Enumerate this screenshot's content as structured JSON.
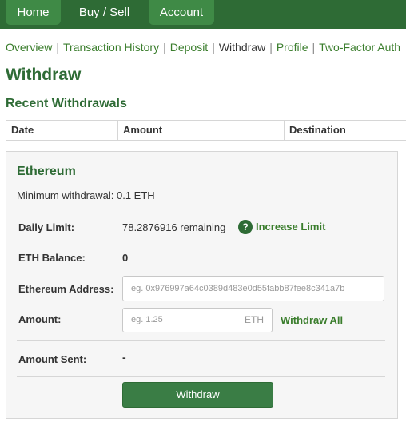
{
  "topnav": {
    "tabs": [
      {
        "label": "Home"
      },
      {
        "label": "Buy / Sell"
      },
      {
        "label": "Account"
      }
    ]
  },
  "subnav": {
    "items": [
      {
        "label": "Overview"
      },
      {
        "label": "Transaction History"
      },
      {
        "label": "Deposit"
      },
      {
        "label": "Withdraw"
      },
      {
        "label": "Profile"
      },
      {
        "label": "Two-Factor Auth"
      }
    ],
    "separator": "|",
    "active": "Withdraw"
  },
  "page": {
    "title": "Withdraw",
    "recent_title": "Recent Withdrawals"
  },
  "table": {
    "columns": [
      "Date",
      "Amount",
      "Destination"
    ]
  },
  "panel": {
    "title": "Ethereum",
    "minimum": "Minimum withdrawal: 0.1 ETH",
    "daily_limit_label": "Daily Limit:",
    "daily_limit_value": "78.2876916 remaining",
    "help_symbol": "?",
    "increase_limit": "Increase Limit",
    "balance_label": "ETH Balance:",
    "balance_value": "0",
    "address_label": "Ethereum Address:",
    "address_placeholder": "eg. 0x976997a64c0389d483e0d55fabb87fee8c341a7b",
    "amount_label": "Amount:",
    "amount_placeholder": "eg. 1.25",
    "amount_unit": "ETH",
    "withdraw_all": "Withdraw All",
    "amount_sent_label": "Amount Sent:",
    "amount_sent_value": "-",
    "withdraw_button": "Withdraw"
  },
  "colors": {
    "nav_bg": "#2e6b35",
    "nav_tab": "#3f8a46",
    "link": "#3a7d2c",
    "heading": "#2e6b35",
    "button": "#3a7d45",
    "panel_bg": "#f6f6f6"
  },
  "icons": {
    "help": "question-circle-icon"
  }
}
